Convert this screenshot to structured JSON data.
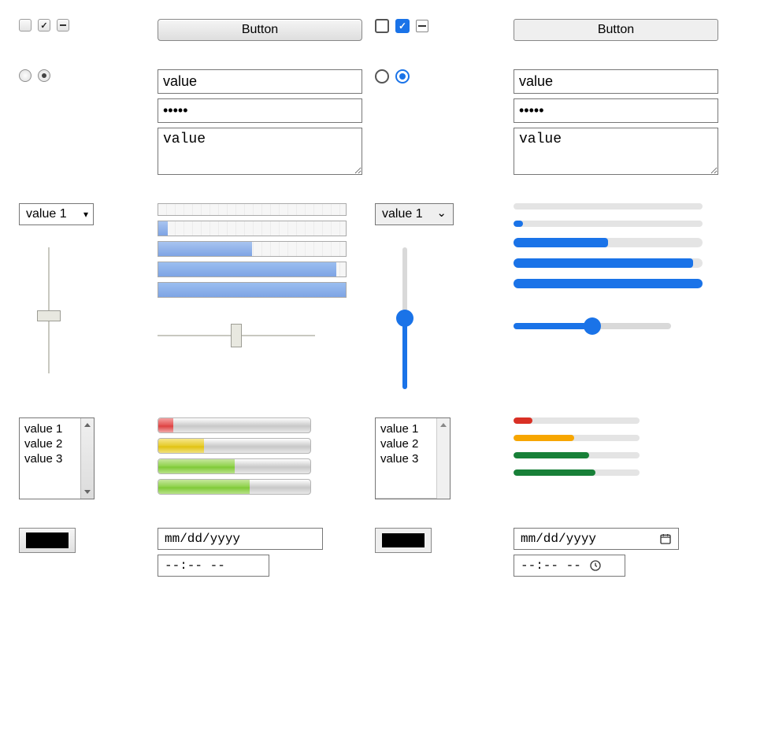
{
  "buttons": {
    "label": "Button"
  },
  "text": {
    "value": "value",
    "password": "•••••",
    "textarea": "value"
  },
  "select": {
    "selected": "value 1",
    "options": [
      "value 1",
      "value 2",
      "value 3"
    ]
  },
  "progress_classic": [
    0,
    5,
    50,
    95,
    100
  ],
  "progress_modern": [
    0,
    5,
    50,
    95,
    100
  ],
  "slider": {
    "v_classic": 50,
    "h_classic": 50,
    "v_modern": 50,
    "h_modern": 50
  },
  "meter_classic": [
    {
      "pct": 10,
      "color": "red"
    },
    {
      "pct": 30,
      "color": "yel"
    },
    {
      "pct": 50,
      "color": "grn"
    },
    {
      "pct": 60,
      "color": "grn"
    }
  ],
  "meter_modern": [
    {
      "pct": 15,
      "color": "red"
    },
    {
      "pct": 48,
      "color": "yel"
    },
    {
      "pct": 60,
      "color": "grn"
    },
    {
      "pct": 65,
      "color": "grn"
    }
  ],
  "listbox": [
    "value 1",
    "value 2",
    "value 3"
  ],
  "color": "#000000",
  "date_placeholder": "mm/dd/yyyy",
  "time_placeholder": "--:-- --"
}
